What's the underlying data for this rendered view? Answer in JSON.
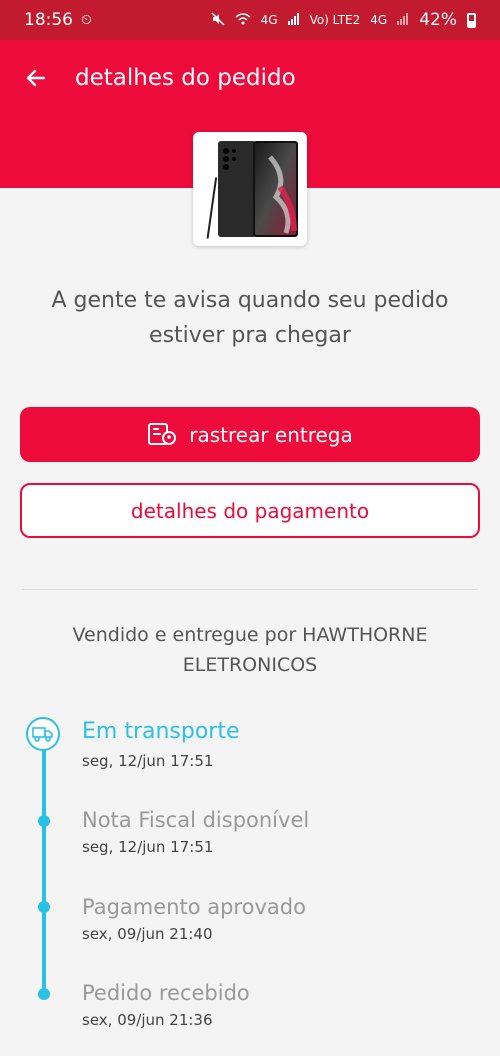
{
  "status_bar": {
    "time": "18:56",
    "network_labels": [
      "4G",
      "Vo) LTE2",
      "4G"
    ],
    "battery": "42%"
  },
  "header": {
    "title": "detalhes do pedido",
    "background_color": "#ec0b3b"
  },
  "product": {
    "image_icon": "samsung-galaxy-phone-with-stylus"
  },
  "main": {
    "headline": "A gente te avisa quando seu pedido estiver pra chegar",
    "track_button_label": "rastrear entrega",
    "payment_button_label": "detalhes do pagamento",
    "seller_info": "Vendido e entregue por HAWTHORNE ELETRONICOS"
  },
  "timeline": [
    {
      "title": "Em transporte",
      "date": "seg, 12/jun 17:51",
      "current": true
    },
    {
      "title": "Nota Fiscal disponível",
      "date": "seg, 12/jun 17:51",
      "current": false
    },
    {
      "title": "Pagamento aprovado",
      "date": "sex, 09/jun 21:40",
      "current": false
    },
    {
      "title": "Pedido recebido",
      "date": "sex, 09/jun 21:36",
      "current": false
    }
  ],
  "colors": {
    "brand": "#ec0b3b",
    "status_bar": "#c21a2e",
    "timeline": "#2bc1e6"
  }
}
